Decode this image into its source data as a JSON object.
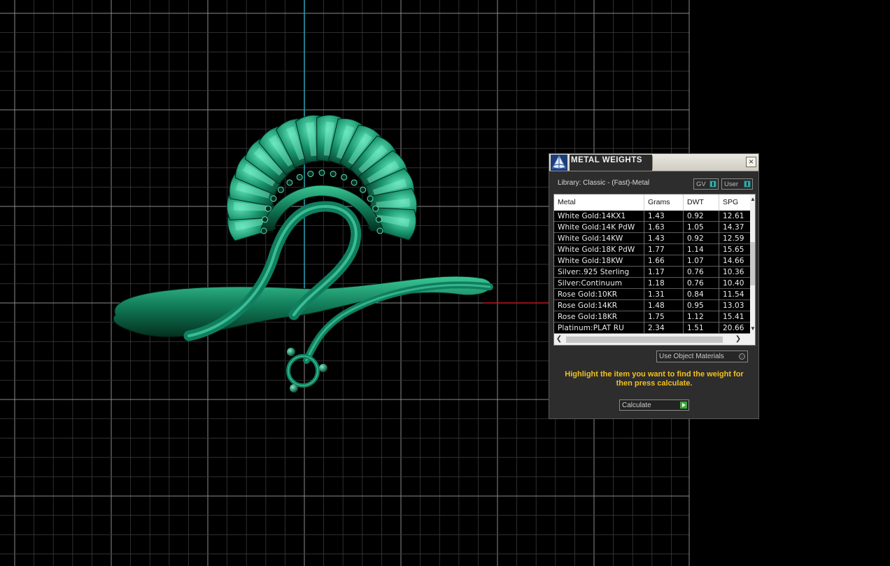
{
  "dialog": {
    "title": "METAL WEIGHTS",
    "library_label": "Library: Classic - (Fast)-Metal",
    "gv_toggle": "GV",
    "user_toggle": "User",
    "use_object_materials": "Use Object Materials",
    "instructions": "Highlight the item you want to find the weight for then press calculate.",
    "calculate_label": "Calculate",
    "close_symbol": "×"
  },
  "table": {
    "headers": [
      "Metal",
      "Grams",
      "DWT",
      "SPG"
    ],
    "rows": [
      [
        "White Gold:14KX1",
        "1.43",
        "0.92",
        "12.61"
      ],
      [
        "White Gold:14K PdW",
        "1.63",
        "1.05",
        "14.37"
      ],
      [
        "White Gold:14KW",
        "1.43",
        "0.92",
        "12.59"
      ],
      [
        "White Gold:18K PdW",
        "1.77",
        "1.14",
        "15.65"
      ],
      [
        "White Gold:18KW",
        "1.66",
        "1.07",
        "14.66"
      ],
      [
        "Silver:.925 Sterling",
        "1.17",
        "0.76",
        "10.36"
      ],
      [
        "Silver:Continuum",
        "1.18",
        "0.76",
        "10.40"
      ],
      [
        "Rose Gold:10KR",
        "1.31",
        "0.84",
        "11.54"
      ],
      [
        "Rose Gold:14KR",
        "1.48",
        "0.95",
        "13.03"
      ],
      [
        "Rose Gold:18KR",
        "1.75",
        "1.12",
        "15.41"
      ],
      [
        "Platinum:PLAT RU",
        "2.34",
        "1.51",
        "20.66"
      ]
    ]
  },
  "colors": {
    "viewport_bg": "#000000",
    "grid_line": "#3a3a3a",
    "axis_y": "#2aa6b8",
    "axis_x": "#c0161a",
    "model": "#0f7f5f",
    "instruction_text": "#f2c11f"
  },
  "icons": {
    "app": "pyramid-icon",
    "close": "close-icon",
    "go": "play-icon"
  }
}
